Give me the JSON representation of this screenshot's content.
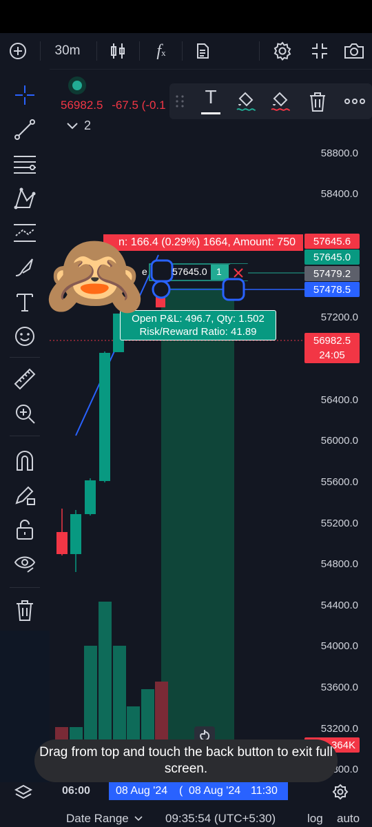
{
  "toolbar": {
    "interval": "30m",
    "add_icon": "plus-circle-icon",
    "candles_icon": "candles-icon",
    "indicators_icon": "fx-icon",
    "notes_icon": "document-icon",
    "settings_icon": "gear-icon",
    "fullscreen_icon": "collapse-icon",
    "snapshot_icon": "camera-icon"
  },
  "legend": {
    "price": "56982.5",
    "change": "-67.5 (-0.1",
    "collapsed_count": "2"
  },
  "floating_toolbar": {
    "text_tool": "T"
  },
  "position": {
    "target_label": "n: 166.4 (0.29%) 1664, Amount: 750",
    "entry_label": "e",
    "entry_value": "57645.0",
    "qty_badge": "1",
    "pnl_line1": "Open P&L: 496.7, Qty: 1.502",
    "pnl_line2": "Risk/Reward Ratio: 41.89"
  },
  "price_axis": {
    "labels": [
      "58800.0",
      "58400.0",
      "57200.0",
      "56400.0",
      "56000.0",
      "55600.0",
      "55200.0",
      "54800.0",
      "54400.0",
      "54000.0",
      "53600.0",
      "53200.0",
      "52800.0"
    ],
    "tags": {
      "target": "57645.6",
      "entry": "57645.0",
      "stop_gray": "57479.2",
      "stop_blue": "57478.5",
      "last_price": "56982.5",
      "countdown": "24:05",
      "volume": "364K"
    }
  },
  "time_axis": {
    "tick": "06:00",
    "range_start": "08 Aug '24",
    "range_end": "08 Aug '24",
    "range_end_time": "11:30"
  },
  "toast": {
    "message": "Drag from top and touch the back button to exit full screen."
  },
  "bottom_bar": {
    "date_range": "Date Range",
    "clock": "09:35:54 (UTC+5:30)",
    "log": "log",
    "auto": "auto"
  },
  "colors": {
    "up": "#089981",
    "down": "#f23645",
    "accent": "#2962ff",
    "profit_zone": "#0f4a3c"
  }
}
